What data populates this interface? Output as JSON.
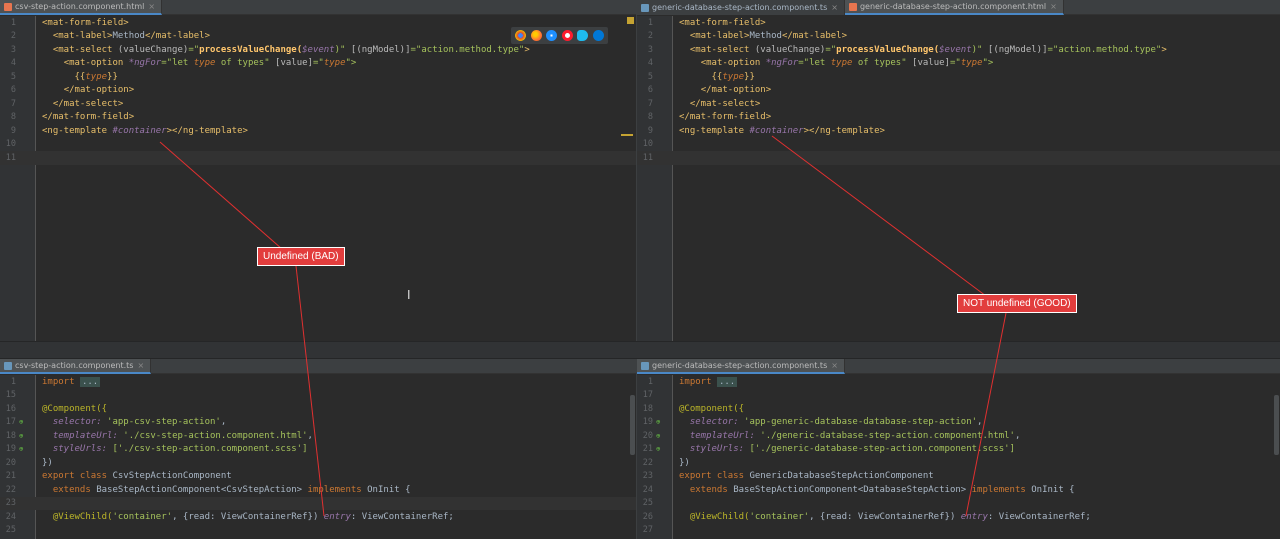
{
  "top_left": {
    "tab": "csv-step-action.component.html",
    "lines": [
      {
        "n": "1"
      },
      {
        "n": "2"
      },
      {
        "n": "3"
      },
      {
        "n": "4"
      },
      {
        "n": "5"
      },
      {
        "n": "6"
      },
      {
        "n": "7"
      },
      {
        "n": "8"
      },
      {
        "n": "9"
      },
      {
        "n": "10"
      },
      {
        "n": "11"
      }
    ]
  },
  "top_right": {
    "tabs": [
      "generic-database-step-action.component.ts",
      "generic-database-step-action.component.html"
    ],
    "lines": [
      {
        "n": "1"
      },
      {
        "n": "2"
      },
      {
        "n": "3"
      },
      {
        "n": "4"
      },
      {
        "n": "5"
      },
      {
        "n": "6"
      },
      {
        "n": "7"
      },
      {
        "n": "8"
      },
      {
        "n": "9"
      },
      {
        "n": "10"
      },
      {
        "n": "11"
      }
    ]
  },
  "bottom_left": {
    "tab": "csv-step-action.component.ts",
    "line_numbers": [
      "1",
      "15",
      "16",
      "17",
      "18",
      "19",
      "20",
      "21",
      "22",
      "23",
      "24",
      "25"
    ]
  },
  "bottom_right": {
    "tab": "generic-database-step-action.component.ts",
    "line_numbers": [
      "1",
      "17",
      "18",
      "19",
      "20",
      "21",
      "22",
      "23",
      "24",
      "25",
      "26",
      "27"
    ]
  },
  "html_code": {
    "l1": "<mat-form-field>",
    "l2_open": "<mat-label>",
    "l2_text": "Method",
    "l2_close": "</mat-label>",
    "l3_open": "<mat-select ",
    "l3_attr1": "(valueChange)",
    "l3_eq1": "=\"",
    "l3_fn": "processValueChange(",
    "l3_ev": "$event",
    "l3_end1": ")\" ",
    "l3_attr2": "[(ngModel)]",
    "l3_val2": "=\"action.method.type\"",
    "l3_close": ">",
    "l4_open": "<mat-option ",
    "l4_attr1": "*ngFor",
    "l4_v1a": "=\"let ",
    "l4_v1b": "type",
    "l4_v1c": " of types\" ",
    "l4_attr2": "[value]",
    "l4_v2a": "=\"",
    "l4_v2b": "type",
    "l4_v2c": "\">",
    "l5_a": "{{",
    "l5_b": "type",
    "l5_c": "}}",
    "l6": "</mat-option>",
    "l7": "</mat-select>",
    "l8": "</mat-form-field>",
    "l9_open": "<ng-template ",
    "l9_ref": "#container",
    "l9_close": "></ng-template>"
  },
  "ts_left": {
    "import_kw": "import",
    "import_fold": "...",
    "component": "@Component({",
    "selector_key": "selector: ",
    "selector_val": "'app-csv-step-action'",
    "comma": ",",
    "template_key": "templateUrl: ",
    "template_val": "'./csv-step-action.component.html'",
    "style_key": "styleUrls: ",
    "style_val": "['./csv-step-action.component.scss']",
    "close": "})",
    "export_kw": "export class ",
    "class_name": "CsvStepActionComponent",
    "extends_kw": "extends ",
    "base": "BaseStepActionComponent<CsvStepAction> ",
    "impl_kw": "implements ",
    "iface": "OnInit {",
    "vc_ann": "@ViewChild(",
    "vc_str": "'container'",
    "vc_mid": ", {read: ViewContainerRef}) ",
    "vc_field": "entry",
    "vc_type": ": ViewContainerRef;"
  },
  "ts_right": {
    "import_kw": "import",
    "import_fold": "...",
    "component": "@Component({",
    "selector_key": "selector: ",
    "selector_val": "'app-generic-database-database-step-action'",
    "comma": ",",
    "template_key": "templateUrl: ",
    "template_val": "'./generic-database-step-action.component.html'",
    "style_key": "styleUrls: ",
    "style_val": "['./generic-database-step-action.component.scss']",
    "close": "})",
    "export_kw": "export class ",
    "class_name": "GenericDatabaseStepActionComponent",
    "extends_kw": "extends ",
    "base": "BaseStepActionComponent<DatabaseStepAction> ",
    "impl_kw": "implements ",
    "iface": "OnInit {",
    "vc_ann": "@ViewChild(",
    "vc_str": "'container'",
    "vc_mid": ", {read: ViewContainerRef}) ",
    "vc_field": "entry",
    "vc_type": ": ViewContainerRef;"
  },
  "annotations": {
    "bad": "Undefined (BAD)",
    "good": "NOT undefined (GOOD)"
  },
  "colors": {
    "editor_bg": "#2b2b2b",
    "label_red": "#e23d3d",
    "arrow_red": "#e03030"
  },
  "browser_icons": [
    "chrome-icon",
    "firefox-icon",
    "safari-icon",
    "opera-icon",
    "ie-icon",
    "edge-icon"
  ]
}
